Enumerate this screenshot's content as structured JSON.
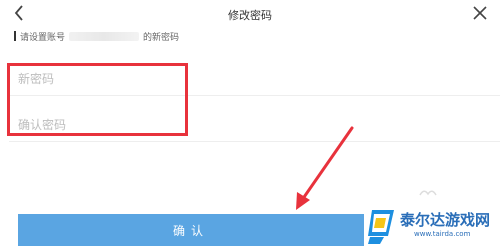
{
  "header": {
    "title": "修改密码"
  },
  "tip": {
    "prefix": "请设置账号",
    "suffix": "的新密码"
  },
  "form": {
    "new_password_placeholder": "新密码",
    "confirm_password_placeholder": "确认密码"
  },
  "confirm_button_label": "确认",
  "watermark": {
    "name": "泰尔达游戏网",
    "url": "www.tairda.com"
  },
  "colors": {
    "accent": "#5aa5e2",
    "highlight": "#e8323c"
  }
}
